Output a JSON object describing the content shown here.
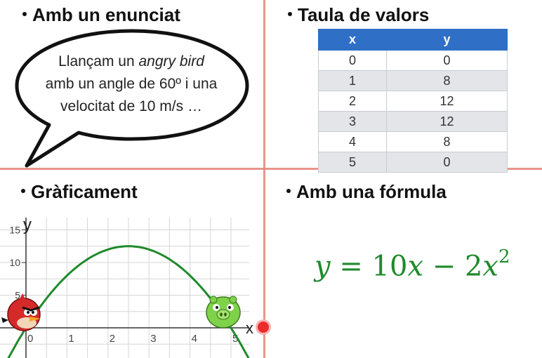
{
  "headings": {
    "statement": "Amb un enunciat",
    "table": "Taula de valors",
    "graph": "Gràficament",
    "formula": "Amb una fórmula"
  },
  "bubble": {
    "line1_pre": "Llançam un ",
    "line1_em": "angry bird",
    "line2": "amb un angle de 60º i una",
    "line3": "velocitat de 10 m/s …"
  },
  "table": {
    "headers": [
      "x",
      "y"
    ],
    "rows": [
      [
        "0",
        "0"
      ],
      [
        "1",
        "8"
      ],
      [
        "2",
        "12"
      ],
      [
        "3",
        "12"
      ],
      [
        "4",
        "8"
      ],
      [
        "5",
        "0"
      ]
    ]
  },
  "chart_data": {
    "type": "line",
    "xlabel": "x",
    "ylabel": "y",
    "x_ticks": [
      "0",
      "1",
      "2",
      "3",
      "4",
      "5"
    ],
    "y_ticks": [
      "5",
      "10",
      "15"
    ],
    "xlim": [
      -0.6,
      5.6
    ],
    "ylim": [
      -6,
      16
    ],
    "grid": true,
    "series": [
      {
        "function": "y = 10x - 2x^2",
        "x": [
          -0.5,
          0,
          0.5,
          1,
          1.5,
          2,
          2.5,
          3,
          3.5,
          4,
          4.5,
          5,
          5.5
        ],
        "y": [
          -5.5,
          0,
          4.5,
          8,
          10.5,
          12,
          12.5,
          12,
          10.5,
          8,
          4.5,
          0,
          -5.5
        ]
      }
    ],
    "color": "#1f8a2b"
  },
  "formula": {
    "y": "y",
    "eq": " = 10",
    "x1": "x",
    "minus": " − 2",
    "x2": "x",
    "exp": "2"
  },
  "colors": {
    "divider": "#e58a80",
    "table_header": "#2f6fc6",
    "curve": "#1f8a2b",
    "red_bird": "#d42a2a",
    "green_pig": "#7ed24a"
  },
  "icons": [
    "red-bird-icon",
    "green-pig-icon"
  ]
}
